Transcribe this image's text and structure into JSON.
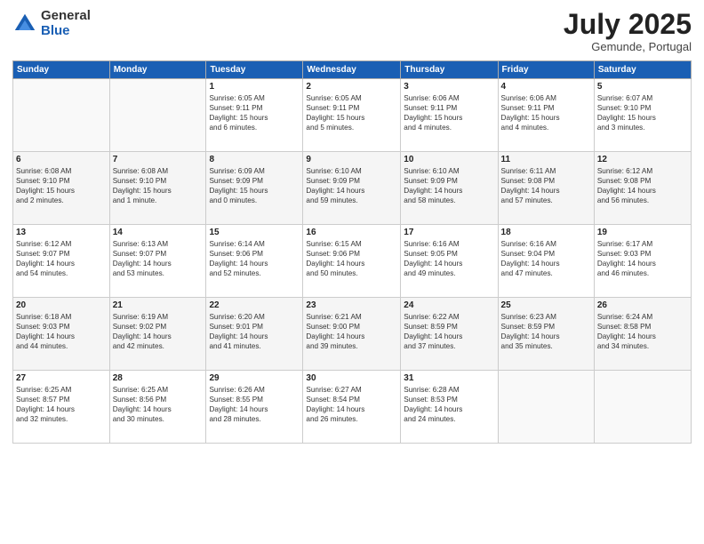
{
  "logo": {
    "general": "General",
    "blue": "Blue"
  },
  "title": "July 2025",
  "subtitle": "Gemunde, Portugal",
  "days_header": [
    "Sunday",
    "Monday",
    "Tuesday",
    "Wednesday",
    "Thursday",
    "Friday",
    "Saturday"
  ],
  "weeks": [
    [
      {
        "day": "",
        "info": ""
      },
      {
        "day": "",
        "info": ""
      },
      {
        "day": "1",
        "info": "Sunrise: 6:05 AM\nSunset: 9:11 PM\nDaylight: 15 hours\nand 6 minutes."
      },
      {
        "day": "2",
        "info": "Sunrise: 6:05 AM\nSunset: 9:11 PM\nDaylight: 15 hours\nand 5 minutes."
      },
      {
        "day": "3",
        "info": "Sunrise: 6:06 AM\nSunset: 9:11 PM\nDaylight: 15 hours\nand 4 minutes."
      },
      {
        "day": "4",
        "info": "Sunrise: 6:06 AM\nSunset: 9:11 PM\nDaylight: 15 hours\nand 4 minutes."
      },
      {
        "day": "5",
        "info": "Sunrise: 6:07 AM\nSunset: 9:10 PM\nDaylight: 15 hours\nand 3 minutes."
      }
    ],
    [
      {
        "day": "6",
        "info": "Sunrise: 6:08 AM\nSunset: 9:10 PM\nDaylight: 15 hours\nand 2 minutes."
      },
      {
        "day": "7",
        "info": "Sunrise: 6:08 AM\nSunset: 9:10 PM\nDaylight: 15 hours\nand 1 minute."
      },
      {
        "day": "8",
        "info": "Sunrise: 6:09 AM\nSunset: 9:09 PM\nDaylight: 15 hours\nand 0 minutes."
      },
      {
        "day": "9",
        "info": "Sunrise: 6:10 AM\nSunset: 9:09 PM\nDaylight: 14 hours\nand 59 minutes."
      },
      {
        "day": "10",
        "info": "Sunrise: 6:10 AM\nSunset: 9:09 PM\nDaylight: 14 hours\nand 58 minutes."
      },
      {
        "day": "11",
        "info": "Sunrise: 6:11 AM\nSunset: 9:08 PM\nDaylight: 14 hours\nand 57 minutes."
      },
      {
        "day": "12",
        "info": "Sunrise: 6:12 AM\nSunset: 9:08 PM\nDaylight: 14 hours\nand 56 minutes."
      }
    ],
    [
      {
        "day": "13",
        "info": "Sunrise: 6:12 AM\nSunset: 9:07 PM\nDaylight: 14 hours\nand 54 minutes."
      },
      {
        "day": "14",
        "info": "Sunrise: 6:13 AM\nSunset: 9:07 PM\nDaylight: 14 hours\nand 53 minutes."
      },
      {
        "day": "15",
        "info": "Sunrise: 6:14 AM\nSunset: 9:06 PM\nDaylight: 14 hours\nand 52 minutes."
      },
      {
        "day": "16",
        "info": "Sunrise: 6:15 AM\nSunset: 9:06 PM\nDaylight: 14 hours\nand 50 minutes."
      },
      {
        "day": "17",
        "info": "Sunrise: 6:16 AM\nSunset: 9:05 PM\nDaylight: 14 hours\nand 49 minutes."
      },
      {
        "day": "18",
        "info": "Sunrise: 6:16 AM\nSunset: 9:04 PM\nDaylight: 14 hours\nand 47 minutes."
      },
      {
        "day": "19",
        "info": "Sunrise: 6:17 AM\nSunset: 9:03 PM\nDaylight: 14 hours\nand 46 minutes."
      }
    ],
    [
      {
        "day": "20",
        "info": "Sunrise: 6:18 AM\nSunset: 9:03 PM\nDaylight: 14 hours\nand 44 minutes."
      },
      {
        "day": "21",
        "info": "Sunrise: 6:19 AM\nSunset: 9:02 PM\nDaylight: 14 hours\nand 42 minutes."
      },
      {
        "day": "22",
        "info": "Sunrise: 6:20 AM\nSunset: 9:01 PM\nDaylight: 14 hours\nand 41 minutes."
      },
      {
        "day": "23",
        "info": "Sunrise: 6:21 AM\nSunset: 9:00 PM\nDaylight: 14 hours\nand 39 minutes."
      },
      {
        "day": "24",
        "info": "Sunrise: 6:22 AM\nSunset: 8:59 PM\nDaylight: 14 hours\nand 37 minutes."
      },
      {
        "day": "25",
        "info": "Sunrise: 6:23 AM\nSunset: 8:59 PM\nDaylight: 14 hours\nand 35 minutes."
      },
      {
        "day": "26",
        "info": "Sunrise: 6:24 AM\nSunset: 8:58 PM\nDaylight: 14 hours\nand 34 minutes."
      }
    ],
    [
      {
        "day": "27",
        "info": "Sunrise: 6:25 AM\nSunset: 8:57 PM\nDaylight: 14 hours\nand 32 minutes."
      },
      {
        "day": "28",
        "info": "Sunrise: 6:25 AM\nSunset: 8:56 PM\nDaylight: 14 hours\nand 30 minutes."
      },
      {
        "day": "29",
        "info": "Sunrise: 6:26 AM\nSunset: 8:55 PM\nDaylight: 14 hours\nand 28 minutes."
      },
      {
        "day": "30",
        "info": "Sunrise: 6:27 AM\nSunset: 8:54 PM\nDaylight: 14 hours\nand 26 minutes."
      },
      {
        "day": "31",
        "info": "Sunrise: 6:28 AM\nSunset: 8:53 PM\nDaylight: 14 hours\nand 24 minutes."
      },
      {
        "day": "",
        "info": ""
      },
      {
        "day": "",
        "info": ""
      }
    ]
  ]
}
